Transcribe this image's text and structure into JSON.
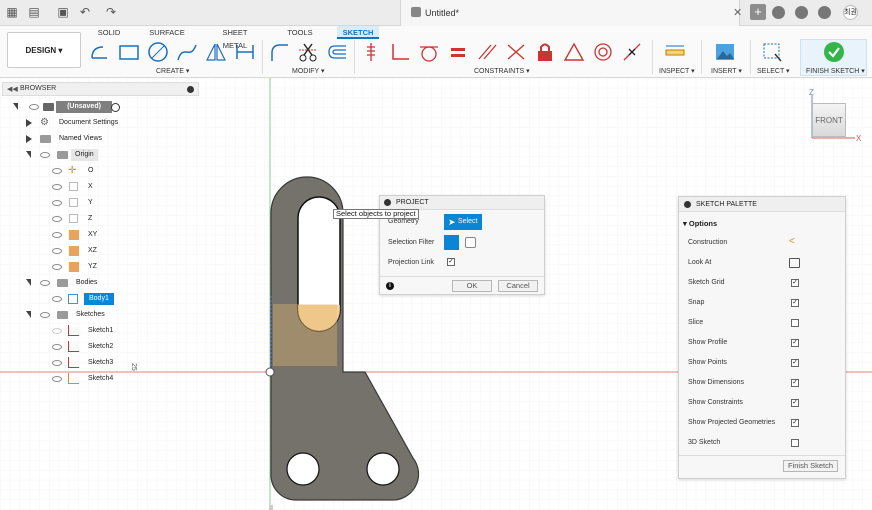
{
  "titlebar": {
    "document_title": "Untitled*",
    "user_initials": "최권"
  },
  "ribbon": {
    "workspace_button": "DESIGN ▾",
    "tabs": [
      "SOLID",
      "SURFACE",
      "SHEET METAL",
      "TOOLS",
      "SKETCH"
    ],
    "active_tab": "SKETCH",
    "groups": {
      "create": "CREATE ▾",
      "modify": "MODIFY ▾",
      "constraints": "CONSTRAINTS ▾",
      "inspect": "INSPECT ▾",
      "insert": "INSERT ▾",
      "select": "SELECT ▾",
      "finish": "FINISH SKETCH ▾"
    }
  },
  "browser": {
    "title": "BROWSER",
    "root": "(Unsaved)",
    "items": {
      "document_settings": "Document Settings",
      "named_views": "Named Views",
      "origin": "Origin",
      "origin_o": "O",
      "origin_x": "X",
      "origin_y": "Y",
      "origin_z": "Z",
      "origin_xy": "XY",
      "origin_xz": "XZ",
      "origin_yz": "YZ",
      "bodies": "Bodies",
      "body1": "Body1",
      "sketches": "Sketches",
      "sketch1": "Sketch1",
      "sketch2": "Sketch2",
      "sketch3": "Sketch3",
      "sketch4": "Sketch4"
    }
  },
  "viewport": {
    "dimension_text": "25",
    "axis_z": "Z",
    "axis_x": "X",
    "view_cube_face": "FRONT",
    "tooltip": "Select objects to project"
  },
  "project_dialog": {
    "title": "PROJECT",
    "geometry_label": "Geometry",
    "select_button": "Select",
    "selection_filter_label": "Selection Filter",
    "projection_link_label": "Projection Link",
    "projection_link_checked": true,
    "ok": "OK",
    "cancel": "Cancel"
  },
  "sketch_palette": {
    "title": "SKETCH PALETTE",
    "section": "Options",
    "options": [
      {
        "label": "Construction"
      },
      {
        "label": "Look At"
      },
      {
        "label": "Sketch Grid",
        "checked": true
      },
      {
        "label": "Snap",
        "checked": true
      },
      {
        "label": "Slice",
        "checked": false
      },
      {
        "label": "Show Profile",
        "checked": true
      },
      {
        "label": "Show Points",
        "checked": true
      },
      {
        "label": "Show Dimensions",
        "checked": true
      },
      {
        "label": "Show Constraints",
        "checked": true
      },
      {
        "label": "Show Projected Geometries",
        "checked": true
      },
      {
        "label": "3D Sketch",
        "checked": false
      }
    ],
    "finish_button": "Finish Sketch"
  },
  "colors": {
    "accent": "#0a86d6",
    "part_fill": "#75716b",
    "profile_fill": "#f4c98a",
    "x_axis": "#d85a5a",
    "z_axis": "#6bbf6b"
  }
}
